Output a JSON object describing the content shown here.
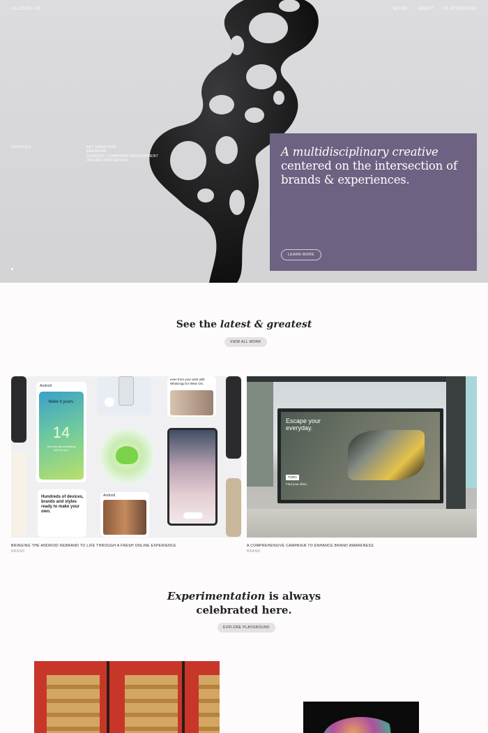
{
  "brand": {
    "logo": "ALLISON XO"
  },
  "nav": {
    "items": [
      "WORK",
      "ABOUT",
      "PLAYGROUND"
    ]
  },
  "hero": {
    "services_label": "SERVICES",
    "services": [
      "ART DIRECTION",
      "BRANDING",
      "CONCEPT / CAMPAIGN DEVELOPMENT",
      "INTERACTION DESIGN"
    ],
    "headline_italic": "A multidisciplinary creative",
    "headline_rest": "centered on the intersection of brands & experiences.",
    "cta": "LEARN MORE",
    "card_color": "#6d6282"
  },
  "latest": {
    "title_pre": "See the ",
    "title_italic": "latest & greatest",
    "cta": "VIEW ALL WORK"
  },
  "work": [
    {
      "caption": "BRINGING THE ANDROID REBRAND TO LIFE THROUGH A FRESH ONLINE EXPERIENCE",
      "tag": "BRAND",
      "screens": {
        "android": "Android",
        "make_it_yours": "Make it yours.",
        "fourteen": "14",
        "new_for_you": "Here we got something new for you.",
        "wrist": "even from your wrist with WhatsApp for Wear OS.",
        "hundreds": "Hundreds of devices, brands and styles ready to make your own.",
        "android_small": "Android"
      }
    },
    {
      "caption": "A COMPREHENSIVE CAMPAIGN TO ENHANCE BRAND AWARENESS",
      "tag": "BRAND",
      "billboard": {
        "headline": "Escape your everyday.",
        "brand": "TURO",
        "tagline": "Find your drive."
      }
    }
  ],
  "playground": {
    "title_italic": "Experimentation",
    "title_rest_1": " is always",
    "title_rest_2": "celebrated here.",
    "cta": "EXPLORE PLAYGROUND"
  }
}
